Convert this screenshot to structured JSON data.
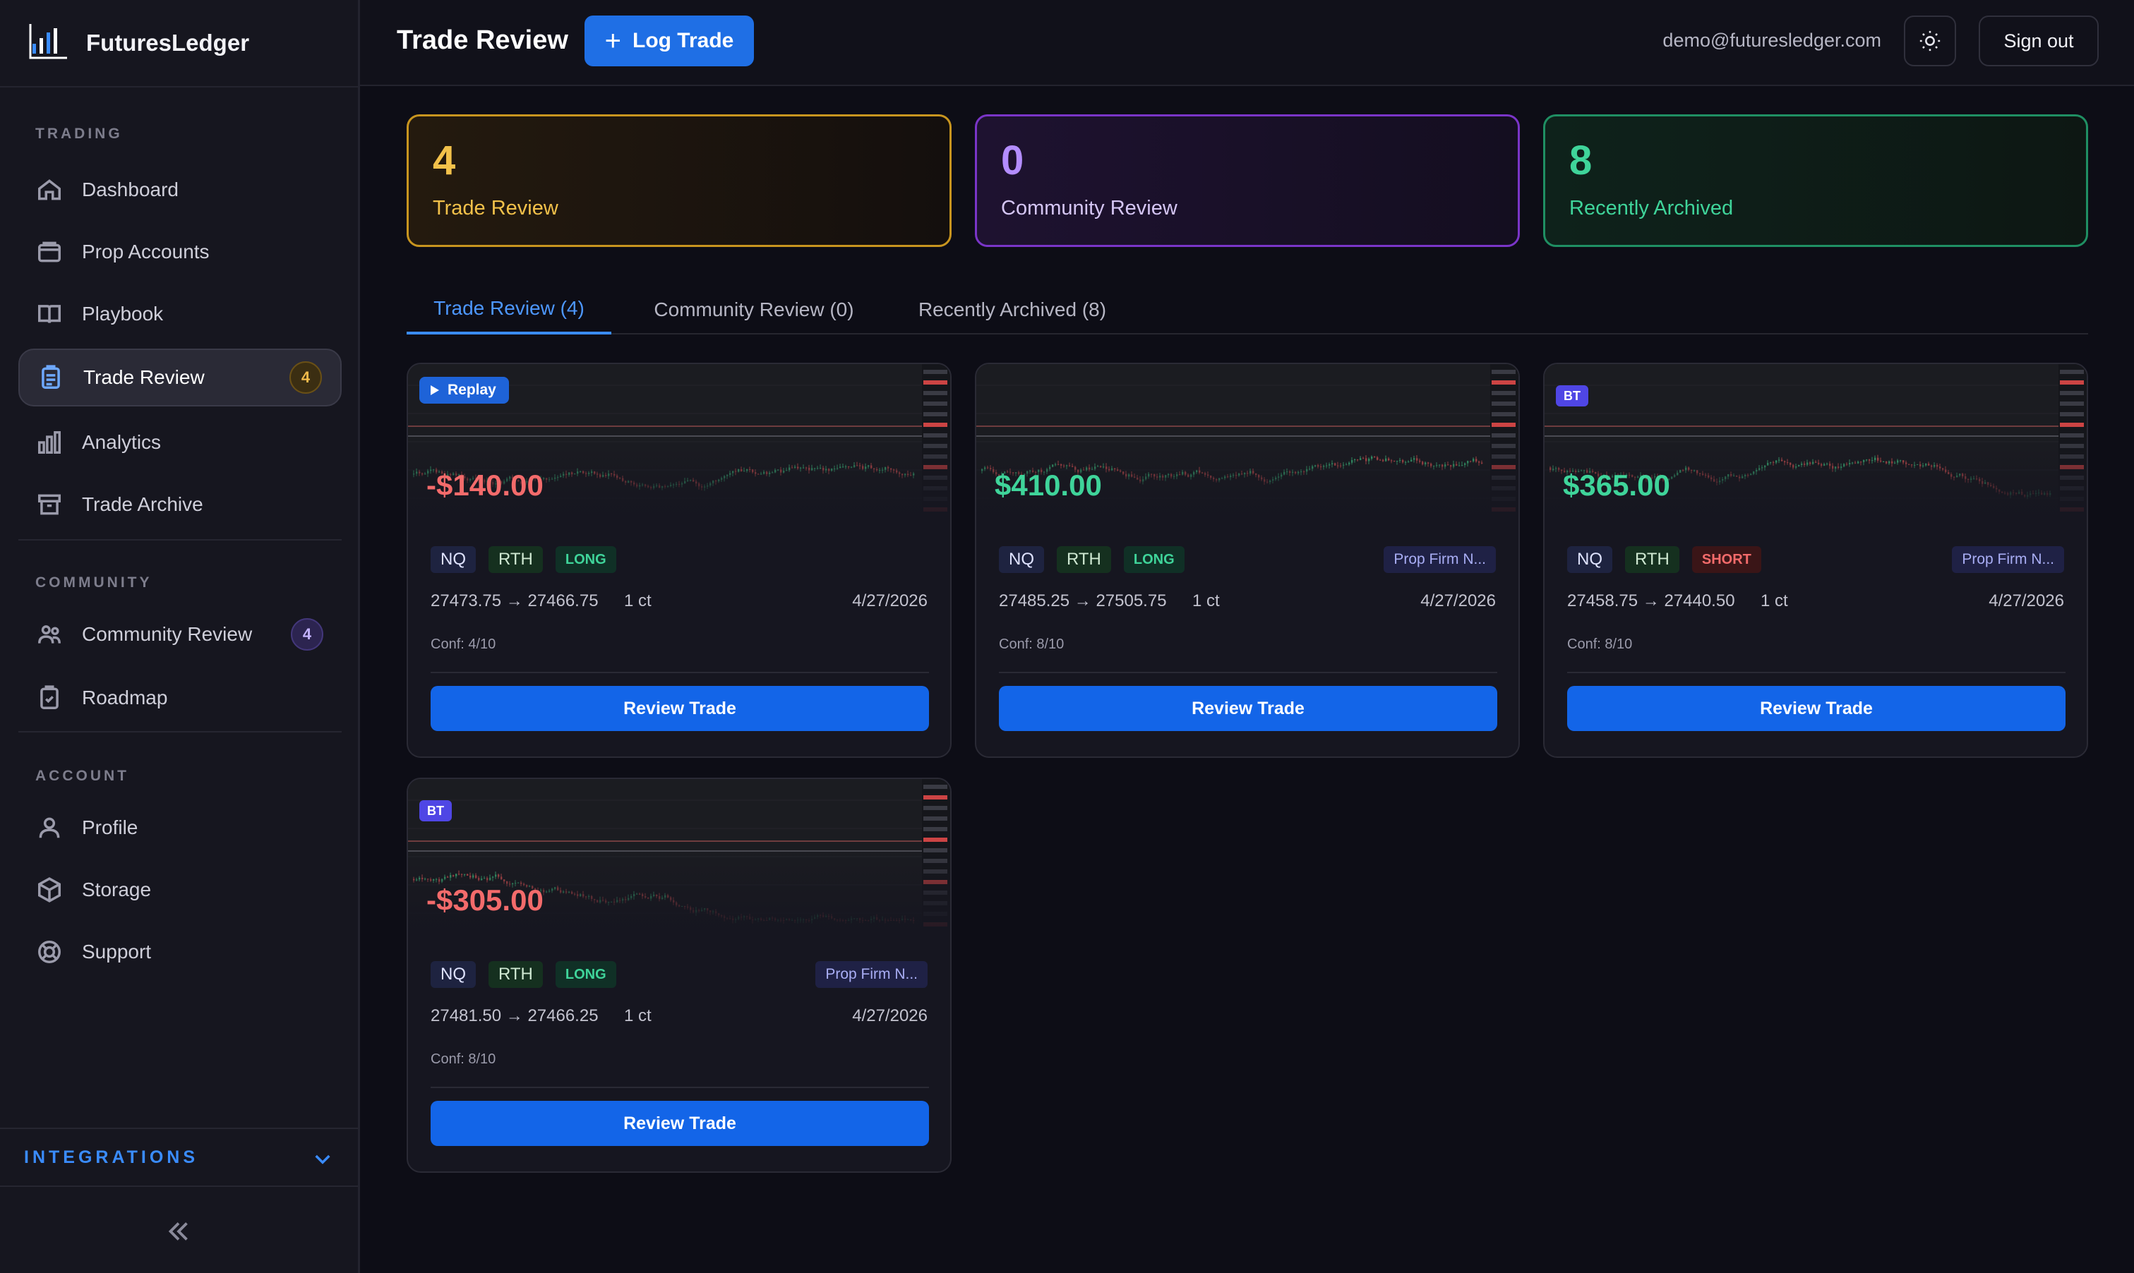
{
  "app": {
    "name": "FuturesLedger"
  },
  "sidebar": {
    "sections": {
      "trading": "TRADING",
      "community": "COMMUNITY",
      "account": "ACCOUNT"
    },
    "items": {
      "dashboard": {
        "label": "Dashboard",
        "icon": "home-icon"
      },
      "prop_accounts": {
        "label": "Prop Accounts",
        "icon": "wallet-icon"
      },
      "playbook": {
        "label": "Playbook",
        "icon": "book-icon"
      },
      "trade_review": {
        "label": "Trade Review",
        "icon": "clipboard-icon",
        "badge": "4"
      },
      "analytics": {
        "label": "Analytics",
        "icon": "bar-chart-icon"
      },
      "trade_archive": {
        "label": "Trade Archive",
        "icon": "archive-icon"
      },
      "community_review": {
        "label": "Community Review",
        "icon": "users-icon",
        "badge": "4"
      },
      "roadmap": {
        "label": "Roadmap",
        "icon": "clipboard-check-icon"
      },
      "profile": {
        "label": "Profile",
        "icon": "user-icon"
      },
      "storage": {
        "label": "Storage",
        "icon": "box-icon"
      },
      "support": {
        "label": "Support",
        "icon": "lifebuoy-icon"
      }
    },
    "integrations": "INTEGRATIONS",
    "active": "trade_review"
  },
  "header": {
    "title": "Trade Review",
    "log_trade": "Log Trade",
    "email": "demo@futuresledger.com",
    "sign_out": "Sign out"
  },
  "stats": {
    "trade_review": {
      "count": "4",
      "label": "Trade Review",
      "color": "#f2c14a"
    },
    "community_review": {
      "count": "0",
      "label": "Community Review",
      "color": "#b48dff"
    },
    "recently_archived": {
      "count": "8",
      "label": "Recently Archived",
      "color": "#3fd49a"
    }
  },
  "tabs": {
    "trade_review": "Trade Review (4)",
    "community_review": "Community Review (0)",
    "recently_archived": "Recently Archived (8)"
  },
  "colors": {
    "accent": "#1f6fe5",
    "profit": "#3fd49a",
    "loss": "#f36b6b"
  },
  "cards": [
    {
      "tag": "Replay",
      "pnl": "-$140.00",
      "symbol": "NQ",
      "session": "RTH",
      "direction": "LONG",
      "prop": "",
      "prices": "27473.75 → 27466.75",
      "qty": "1 ct",
      "date": "4/27/2026",
      "conf": "Conf: 4/10",
      "button": "Review Trade"
    },
    {
      "tag": "",
      "pnl": "$410.00",
      "symbol": "NQ",
      "session": "RTH",
      "direction": "LONG",
      "prop": "Prop Firm N...",
      "prices": "27485.25 → 27505.75",
      "qty": "1 ct",
      "date": "4/27/2026",
      "conf": "Conf: 8/10",
      "button": "Review Trade"
    },
    {
      "tag": "BT",
      "pnl": "$365.00",
      "symbol": "NQ",
      "session": "RTH",
      "direction": "SHORT",
      "prop": "Prop Firm N...",
      "prices": "27458.75 → 27440.50",
      "qty": "1 ct",
      "date": "4/27/2026",
      "conf": "Conf: 8/10",
      "button": "Review Trade"
    },
    {
      "tag": "BT",
      "pnl": "-$305.00",
      "symbol": "NQ",
      "session": "RTH",
      "direction": "LONG",
      "prop": "Prop Firm N...",
      "prices": "27481.50 → 27466.25",
      "qty": "1 ct",
      "date": "4/27/2026",
      "conf": "Conf: 8/10",
      "button": "Review Trade"
    }
  ]
}
